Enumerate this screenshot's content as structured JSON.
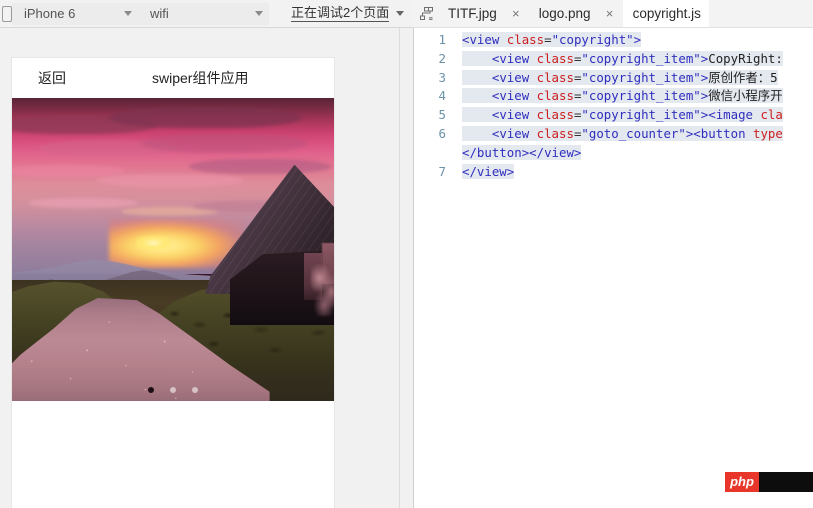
{
  "simulator": {
    "toolbar": {
      "device_select": {
        "value": "iPhone 6",
        "icon": "device-frame-icon"
      },
      "network_select": {
        "value": "wifi"
      },
      "debug_status": "正在调试2个页面"
    },
    "phone": {
      "navbar": {
        "back_label": "返回",
        "title": "swiper组件应用"
      },
      "swiper": {
        "image_alt": "sunset-landscape-barn",
        "dots": [
          {
            "active": true
          },
          {
            "active": false
          },
          {
            "active": false
          }
        ]
      }
    }
  },
  "editor": {
    "tabbar": {
      "structure_icon": "tree-structure-icon",
      "tabs": [
        {
          "label": "TITF.jpg",
          "close": "×",
          "active": false
        },
        {
          "label": "logo.png",
          "close": "×",
          "active": false
        },
        {
          "label": "copyright.js",
          "close": "",
          "active": true
        }
      ]
    },
    "gutter": [
      "1",
      "2",
      "3",
      "4",
      "5",
      "6",
      "",
      "7"
    ],
    "lines": [
      {
        "number": "1",
        "tokens": [
          {
            "t": "punct",
            "v": "<"
          },
          {
            "t": "tag",
            "v": "view "
          },
          {
            "t": "attr",
            "v": "class"
          },
          {
            "t": "eq",
            "v": "="
          },
          {
            "t": "string",
            "v": "\"copyright\""
          },
          {
            "t": "punct",
            "v": ">"
          }
        ]
      },
      {
        "number": "2",
        "tokens": [
          {
            "t": "plain",
            "v": "    "
          },
          {
            "t": "punct",
            "v": "<"
          },
          {
            "t": "tag",
            "v": "view "
          },
          {
            "t": "attr",
            "v": "class"
          },
          {
            "t": "eq",
            "v": "="
          },
          {
            "t": "string",
            "v": "\"copyright_item\""
          },
          {
            "t": "punct",
            "v": ">"
          },
          {
            "t": "text",
            "v": "CopyRight:"
          }
        ]
      },
      {
        "number": "3",
        "tokens": [
          {
            "t": "plain",
            "v": "    "
          },
          {
            "t": "punct",
            "v": "<"
          },
          {
            "t": "tag",
            "v": "view "
          },
          {
            "t": "attr",
            "v": "class"
          },
          {
            "t": "eq",
            "v": "="
          },
          {
            "t": "string",
            "v": "\"copyright_item\""
          },
          {
            "t": "punct",
            "v": ">"
          },
          {
            "t": "text",
            "v": "原创作者：5"
          }
        ]
      },
      {
        "number": "4",
        "tokens": [
          {
            "t": "plain",
            "v": "    "
          },
          {
            "t": "punct",
            "v": "<"
          },
          {
            "t": "tag",
            "v": "view "
          },
          {
            "t": "attr",
            "v": "class"
          },
          {
            "t": "eq",
            "v": "="
          },
          {
            "t": "string",
            "v": "\"copyright_item\""
          },
          {
            "t": "punct",
            "v": ">"
          },
          {
            "t": "text",
            "v": "微信小程序开"
          }
        ]
      },
      {
        "number": "5",
        "tokens": [
          {
            "t": "plain",
            "v": "    "
          },
          {
            "t": "punct",
            "v": "<"
          },
          {
            "t": "tag",
            "v": "view "
          },
          {
            "t": "attr",
            "v": "class"
          },
          {
            "t": "eq",
            "v": "="
          },
          {
            "t": "string",
            "v": "\"copyright_item\""
          },
          {
            "t": "punct",
            "v": "><"
          },
          {
            "t": "tag",
            "v": "image "
          },
          {
            "t": "attr",
            "v": "cla"
          }
        ]
      },
      {
        "number": "6",
        "tokens": [
          {
            "t": "plain",
            "v": "    "
          },
          {
            "t": "punct",
            "v": "<"
          },
          {
            "t": "tag",
            "v": "view "
          },
          {
            "t": "attr",
            "v": "class"
          },
          {
            "t": "eq",
            "v": "="
          },
          {
            "t": "string",
            "v": "\"goto_counter\""
          },
          {
            "t": "punct",
            "v": "><"
          },
          {
            "t": "tag",
            "v": "button "
          },
          {
            "t": "attr",
            "v": "type"
          }
        ]
      },
      {
        "number": "",
        "tokens": [
          {
            "t": "punct",
            "v": "</"
          },
          {
            "t": "tag",
            "v": "button"
          },
          {
            "t": "punct",
            "v": "></"
          },
          {
            "t": "tag",
            "v": "view"
          },
          {
            "t": "punct",
            "v": ">"
          }
        ]
      },
      {
        "number": "7",
        "tokens": [
          {
            "t": "punct",
            "v": "</"
          },
          {
            "t": "tag",
            "v": "view"
          },
          {
            "t": "punct",
            "v": ">"
          }
        ]
      }
    ]
  },
  "watermark": {
    "php_text": "php"
  },
  "colors": {
    "accent_red": "#e8372a",
    "tag_blue": "#2f2fbf",
    "attr_red": "#cc2020",
    "gutter_blue": "#6a93a8",
    "highlight": "#e4e8ef",
    "toolbar_bg": "#f2f2f2"
  }
}
